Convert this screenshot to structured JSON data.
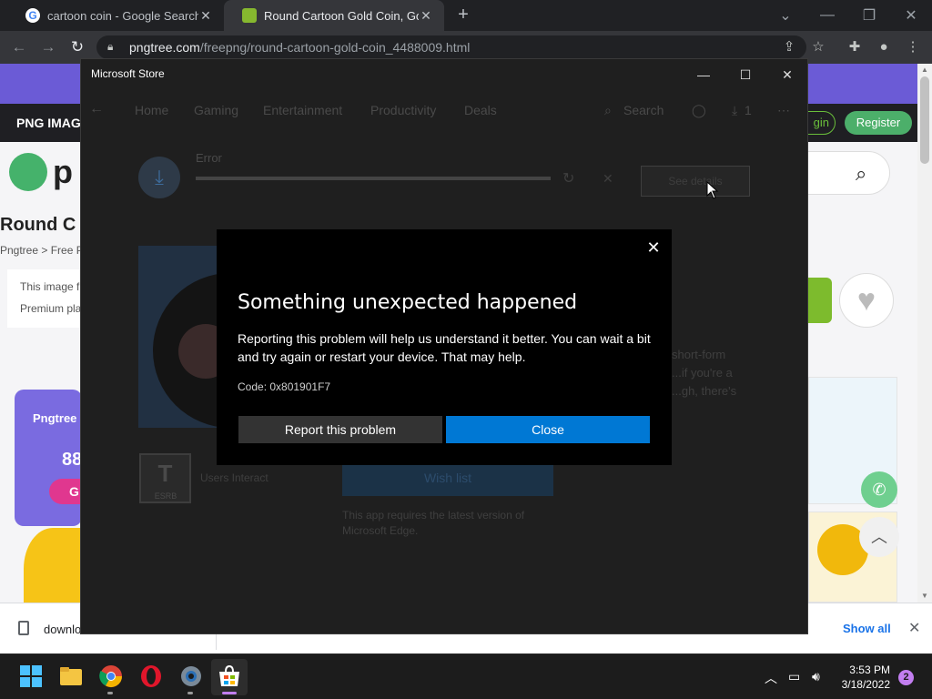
{
  "browser": {
    "tabs": [
      {
        "title": "cartoon coin - Google Search",
        "favicon": "google-icon",
        "active": false
      },
      {
        "title": "Round Cartoon Gold Coin, Gold",
        "favicon": "pngtree-icon",
        "active": true
      }
    ],
    "new_tab_label": "+",
    "url_host": "pngtree.com",
    "url_path": "/freepng/round-cartoon-gold-coin_4488009.html"
  },
  "webpage": {
    "nav_label": "PNG IMAG",
    "login_label": "gin",
    "register_label": "Register",
    "logo_text": "p",
    "heading": "Round C",
    "breadcrumb": "Pngtree > Free P",
    "info_line1": "This image f",
    "info_line2": "Premium pla",
    "promo_title": "Pngtree",
    "promo_price": "88",
    "promo_button": "G"
  },
  "downloads": {
    "file_label": "downlo",
    "show_all": "Show all"
  },
  "store": {
    "window_title": "Microsoft Store",
    "nav": [
      "Home",
      "Gaming",
      "Entertainment",
      "Productivity",
      "Deals"
    ],
    "search_label": "Search",
    "download_count": "1",
    "download_status": "Error",
    "see_details": "See details",
    "rating_text": "Users Interact",
    "esrb_label": "ESRB",
    "wishlist_label": "Wish list",
    "requirement": "This app requires the latest version of Microsoft Edge.",
    "description_snippet": "short-form ...if you're a ...gh, there's"
  },
  "dialog": {
    "title": "Something unexpected happened",
    "body": "Reporting this problem will help us understand it better. You can wait a bit and try again or restart your device. That may help.",
    "code": "Code: 0x801901F7",
    "report_button": "Report this problem",
    "close_button": "Close"
  },
  "taskbar": {
    "apps": [
      "start-icon",
      "file-explorer-icon",
      "chrome-icon",
      "opera-icon",
      "settings-icon",
      "microsoft-store-icon"
    ],
    "time": "3:53 PM",
    "date": "3/18/2022",
    "notification_count": "2"
  },
  "colors": {
    "dialog_primary": "#0078d4",
    "dialog_bg": "#000000",
    "store_bg": "#1f1f1f",
    "taskbar_bg": "#1c1c1c",
    "pngtree_green": "#4caf6a",
    "store_accent": "#c27ef0"
  }
}
